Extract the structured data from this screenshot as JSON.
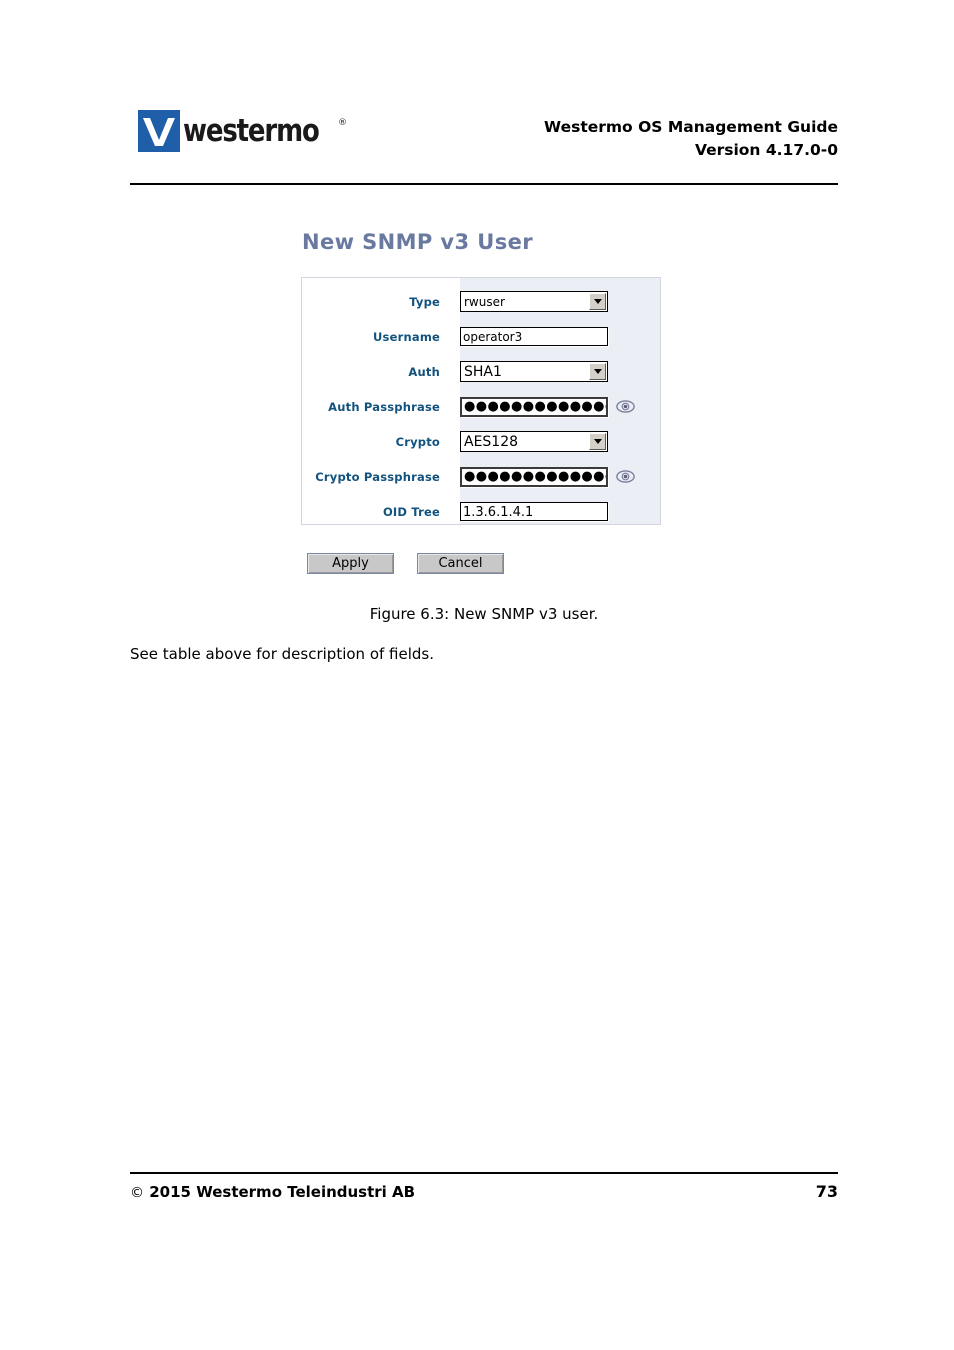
{
  "header": {
    "logo_word": "westermo",
    "logo_registered": "®",
    "title_line1": "Westermo OS Management Guide",
    "title_line2": "Version 4.17.0-0"
  },
  "figure": {
    "panel_heading": "New SNMP v3 User",
    "fields": [
      {
        "label": "Type",
        "control": "select",
        "value": "rwuser",
        "eye": false
      },
      {
        "label": "Username",
        "control": "text",
        "value": "operator3",
        "eye": false
      },
      {
        "label": "Auth",
        "control": "select",
        "value": "SHA1",
        "eye": false
      },
      {
        "label": "Auth Passphrase",
        "control": "password",
        "value": "●●●●●●●●●●●●●●●",
        "eye": true
      },
      {
        "label": "Crypto",
        "control": "select",
        "value": "AES128",
        "eye": false
      },
      {
        "label": "Crypto Passphrase",
        "control": "password",
        "value": "●●●●●●●●●●●●●●●",
        "eye": true
      },
      {
        "label": "OID Tree",
        "control": "text",
        "value": "1.3.6.1.4.1",
        "eye": false
      }
    ],
    "apply_label": "Apply",
    "cancel_label": "Cancel",
    "caption": "Figure 6.3: New SNMP v3 user."
  },
  "body": {
    "paragraph": "See table above for description of fields."
  },
  "footer": {
    "copyright_mark": "©",
    "copyright_text": "2015 Westermo Teleindustri AB",
    "page_number": "73"
  },
  "colors": {
    "logo_blue": "#1f5fa9",
    "heading_blue": "#69799f",
    "label_blue": "#11527e",
    "panel_field_bg": "#eceef5",
    "button_face": "#c8c8c8"
  },
  "icons": {
    "eye": "eye-icon",
    "dropdown": "chevron-down-icon"
  }
}
